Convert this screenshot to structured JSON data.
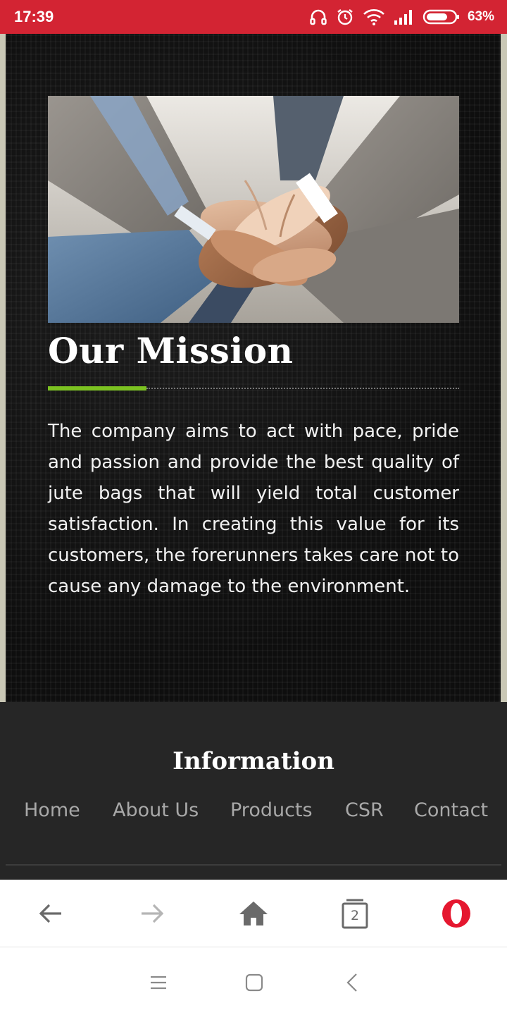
{
  "status_bar": {
    "time": "17:39",
    "battery_percent": "63%",
    "icons": [
      "headphones-icon",
      "alarm-icon",
      "wifi-icon",
      "signal-icon",
      "battery-icon"
    ],
    "background_color": "#d32433"
  },
  "mission": {
    "image_alt": "team hands stacked together",
    "title": "Our Mission",
    "accent_color": "#7cc221",
    "body": "The company aims to act with pace, pride and passion and provide the best quality of jute bags that will yield total customer satisfaction. In creating this value for its customers, the forerunners takes care not to cause any damage to the environment."
  },
  "footer": {
    "title": "Information",
    "links": [
      {
        "label": "Home"
      },
      {
        "label": "About Us"
      },
      {
        "label": "Products"
      },
      {
        "label": "CSR"
      },
      {
        "label": "Contact"
      }
    ]
  },
  "browser_toolbar": {
    "buttons": [
      "back-arrow-icon",
      "forward-arrow-icon",
      "home-icon",
      "tabs-icon",
      "opera-menu-icon"
    ],
    "tab_count": "2",
    "brand_color": "#e5172f"
  },
  "android_nav": {
    "buttons": [
      "menu-icon",
      "home-square-icon",
      "back-chevron-icon"
    ]
  }
}
